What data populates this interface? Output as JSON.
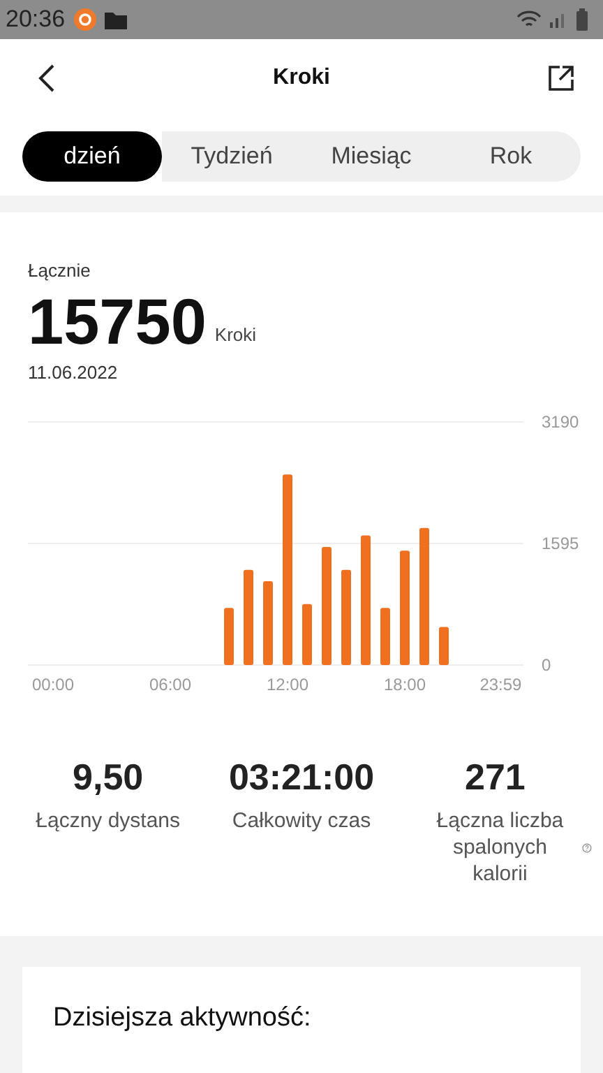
{
  "status_bar": {
    "time": "20:36"
  },
  "header": {
    "title": "Kroki"
  },
  "tabs": [
    {
      "label": "dzień",
      "selected": true
    },
    {
      "label": "Tydzień",
      "selected": false
    },
    {
      "label": "Miesiąc",
      "selected": false
    },
    {
      "label": "Rok",
      "selected": false
    }
  ],
  "summary": {
    "label": "Łącznie",
    "value": "15750",
    "unit": "Kroki",
    "date": "11.06.2022"
  },
  "chart_data": {
    "type": "bar",
    "x": [
      9,
      10,
      11,
      12,
      13,
      14,
      15,
      16,
      17,
      18,
      19,
      20
    ],
    "series": [
      {
        "color": "#f07020",
        "values": [
          750,
          1250,
          1100,
          2500,
          800,
          1550,
          1250,
          1700,
          750,
          1500,
          1800,
          500
        ]
      }
    ],
    "xlim": [
      -1.29,
      24.07
    ],
    "ylim": [
      0,
      3190
    ],
    "yticks": [
      0,
      1595,
      3190
    ],
    "xticks": [
      {
        "value": 0,
        "label": "00:00"
      },
      {
        "value": 6,
        "label": "06:00"
      },
      {
        "value": 12,
        "label": "12:00"
      },
      {
        "value": 18,
        "label": "18:00"
      },
      {
        "value": 23.98,
        "label": "23:59"
      }
    ]
  },
  "stats": [
    {
      "value": "9,50",
      "label": "Łączny dystans",
      "info": false
    },
    {
      "value": "03:21:00",
      "label": "Całkowity czas",
      "info": false
    },
    {
      "value": "271",
      "label": "Łączna liczba spalonych kalorii",
      "info": true
    }
  ],
  "activity": {
    "title": "Dzisiejsza aktywność:"
  }
}
